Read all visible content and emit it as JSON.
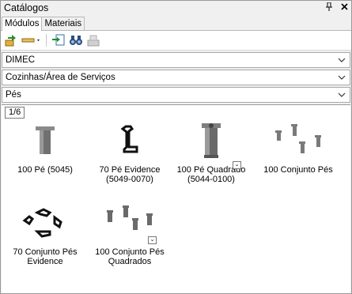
{
  "window": {
    "title": "Catálogos"
  },
  "tabs": [
    {
      "label": "Módulos"
    },
    {
      "label": "Materiais"
    }
  ],
  "selects": [
    {
      "value": "DIMEC"
    },
    {
      "value": "Cozinhas/Área de Serviços"
    },
    {
      "value": "Pés"
    }
  ],
  "pager": {
    "label": "1/6"
  },
  "items": [
    {
      "line1": "100 Pé (5045)",
      "line2": ""
    },
    {
      "line1": "70 Pé Evidence",
      "line2": "(5049-0070)"
    },
    {
      "line1": "100 Pé Quadrado",
      "line2": "(5044-0100)"
    },
    {
      "line1": "100 Conjunto Pés",
      "line2": ""
    },
    {
      "line1": "70 Conjunto Pés",
      "line2": "Evidence"
    },
    {
      "line1": "100 Conjunto Pés",
      "line2": "Quadrados"
    }
  ],
  "icons": [
    "pin-icon",
    "close-icon",
    "add-module-icon",
    "measure-dropdown-icon",
    "import-icon",
    "search-binoculars-icon",
    "stack-icon",
    "chevron-down-icon",
    "more-variants-icon"
  ]
}
